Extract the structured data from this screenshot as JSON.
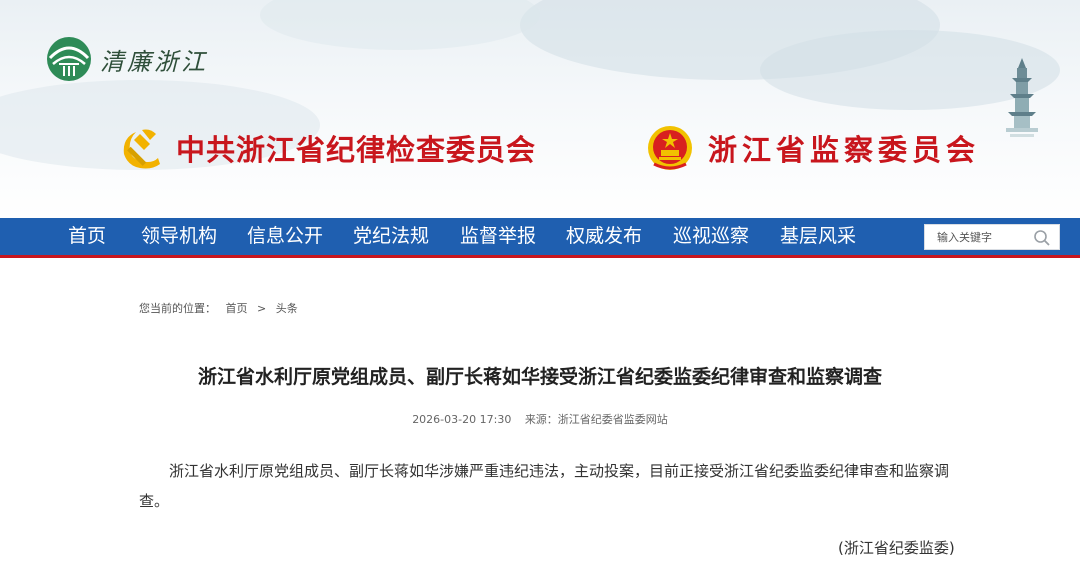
{
  "header": {
    "logo_text": "清廉浙江",
    "logo_icon": "qinglian-zhejiang-logo-icon",
    "pagoda_icon": "pagoda-icon",
    "org1": {
      "icon": "party-emblem-icon",
      "text": "中共浙江省纪律检查委员会"
    },
    "org2": {
      "icon": "national-emblem-icon",
      "text": "浙江省监察委员会"
    }
  },
  "nav": {
    "items": [
      {
        "label": "首页"
      },
      {
        "label": "领导机构"
      },
      {
        "label": "信息公开"
      },
      {
        "label": "党纪法规"
      },
      {
        "label": "监督举报"
      },
      {
        "label": "权威发布"
      },
      {
        "label": "巡视巡察"
      },
      {
        "label": "基层风采"
      }
    ],
    "search": {
      "placeholder": "输入关键字",
      "icon": "search-icon"
    }
  },
  "breadcrumb": {
    "prefix": "您当前的位置：",
    "items": [
      "首页",
      "头条"
    ],
    "separator": ">"
  },
  "article": {
    "title": "浙江省水利厅原党组成员、副厅长蒋如华接受浙江省纪委监委纪律审查和监察调查",
    "datetime": "2026-03-20 17:30",
    "source": "来源：浙江省纪委省监委网站",
    "body": "浙江省水利厅原党组成员、副厅长蒋如华涉嫌严重违纪违法，主动投案，目前正接受浙江省纪委监委纪律审查和监察调查。",
    "signature": "(浙江省纪委监委)"
  },
  "colors": {
    "nav_blue": "#1f5fb0",
    "accent_red": "#c8161d",
    "emblem_gold": "#f2c200"
  }
}
